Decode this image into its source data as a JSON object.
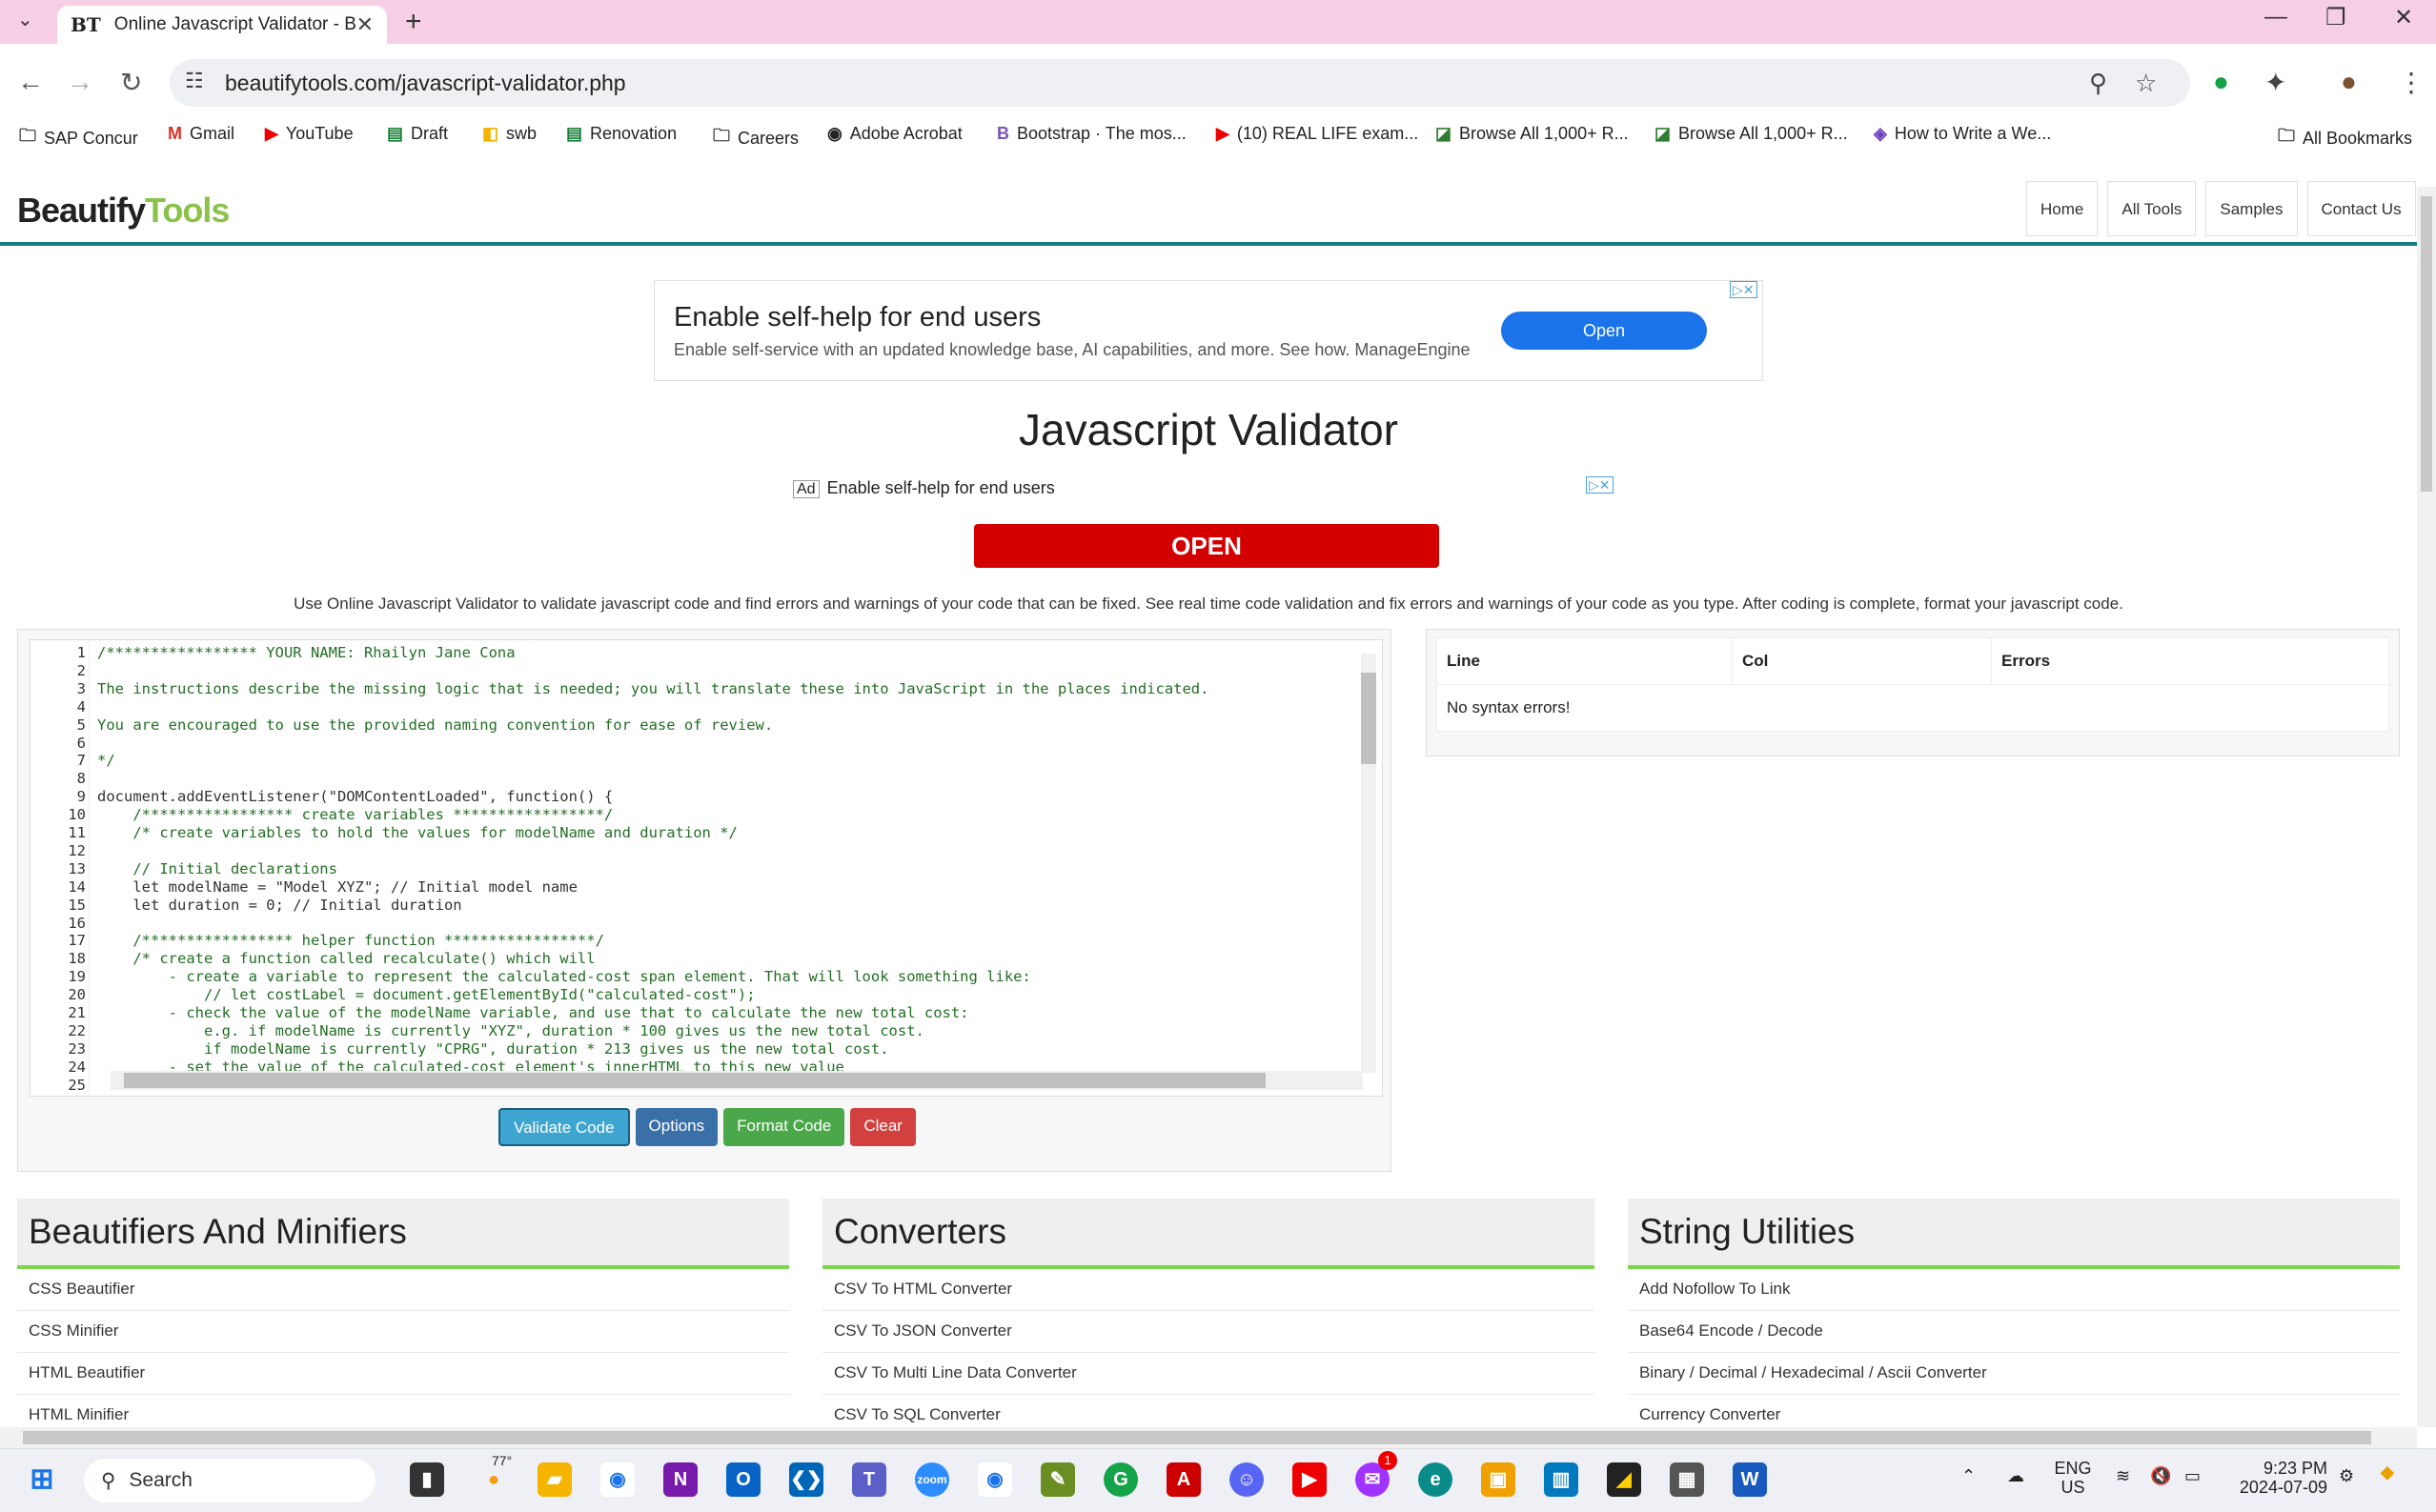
{
  "browser": {
    "tab_favicon": "BT",
    "tab_title": "Online Javascript Validator - Be",
    "url": "beautifytools.com/javascript-validator.php",
    "bookmarks": [
      {
        "label": "SAP Concur",
        "icon": "folder-icon"
      },
      {
        "label": "Gmail",
        "icon": "gmail-icon"
      },
      {
        "label": "YouTube",
        "icon": "youtube-icon"
      },
      {
        "label": "Draft",
        "icon": "docs-icon"
      },
      {
        "label": "swb",
        "icon": "bookmark-icon"
      },
      {
        "label": "Renovation",
        "icon": "docs-icon"
      },
      {
        "label": "Careers",
        "icon": "folder-icon"
      },
      {
        "label": "Adobe Acrobat",
        "icon": "globe-icon"
      },
      {
        "label": "Bootstrap · The mos...",
        "icon": "bootstrap-icon"
      },
      {
        "label": "(10) REAL LIFE exam...",
        "icon": "youtube-icon"
      },
      {
        "label": "Browse All 1,000+ R...",
        "icon": "bookmark-icon"
      },
      {
        "label": "Browse All 1,000+ R...",
        "icon": "bookmark-icon"
      },
      {
        "label": "How to Write a We...",
        "icon": "bookmark-icon"
      }
    ],
    "all_bookmarks": "All Bookmarks"
  },
  "site": {
    "logo_part1": "Beautify",
    "logo_part2": "Tools",
    "nav": [
      "Home",
      "All Tools",
      "Samples",
      "Contact Us"
    ]
  },
  "ad_top": {
    "headline": "Enable self-help for end users",
    "sub": "Enable self-service with an updated knowledge base, AI capabilities, and more. See how. ManageEngine",
    "button": "Open"
  },
  "page_title": "Javascript Validator",
  "ad_mid": {
    "ad_label": "Ad",
    "text": "Enable self-help for end users",
    "button": "OPEN"
  },
  "description": "Use Online Javascript Validator to validate javascript code and find errors and warnings of your code that can be fixed. See real time code validation and fix errors and warnings of your code as you type. After coding is complete, format your javascript code.",
  "editor": {
    "lines": [
      {
        "n": "1",
        "t": "/***************** YOUR NAME: Rhailyn Jane Cona"
      },
      {
        "n": "2",
        "t": ""
      },
      {
        "n": "3",
        "t": "The instructions describe the missing logic that is needed; you will translate these into JavaScript in the places indicated."
      },
      {
        "n": "4",
        "t": ""
      },
      {
        "n": "5",
        "t": "You are encouraged to use the provided naming convention for ease of review."
      },
      {
        "n": "6",
        "t": ""
      },
      {
        "n": "7",
        "t": "*/"
      },
      {
        "n": "8",
        "t": ""
      },
      {
        "n": "9",
        "t": "document.addEventListener(\"DOMContentLoaded\", function() {"
      },
      {
        "n": "10",
        "t": "    /***************** create variables *****************/"
      },
      {
        "n": "11",
        "t": "    /* create variables to hold the values for modelName and duration */"
      },
      {
        "n": "12",
        "t": ""
      },
      {
        "n": "13",
        "t": "    // Initial declarations"
      },
      {
        "n": "14",
        "t": "    let modelName = \"Model XYZ\"; // Initial model name"
      },
      {
        "n": "15",
        "t": "    let duration = 0; // Initial duration"
      },
      {
        "n": "16",
        "t": ""
      },
      {
        "n": "17",
        "t": "    /***************** helper function *****************/"
      },
      {
        "n": "18",
        "t": "    /* create a function called recalculate() which will"
      },
      {
        "n": "19",
        "t": "        - create a variable to represent the calculated-cost span element. That will look something like:"
      },
      {
        "n": "20",
        "t": "            // let costLabel = document.getElementById(\"calculated-cost\");"
      },
      {
        "n": "21",
        "t": "        - check the value of the modelName variable, and use that to calculate the new total cost:"
      },
      {
        "n": "22",
        "t": "            e.g. if modelName is currently \"XYZ\", duration * 100 gives us the new total cost."
      },
      {
        "n": "23",
        "t": "            if modelName is currently \"CPRG\", duration * 213 gives us the new total cost."
      },
      {
        "n": "24",
        "t": "        - set the value of the calculated-cost element's innerHTML to this new value"
      },
      {
        "n": "25",
        "t": ""
      }
    ],
    "buttons": {
      "validate": "Validate Code",
      "options": "Options",
      "format": "Format Code",
      "clear": "Clear"
    }
  },
  "errors": {
    "headers": [
      "Line",
      "Col",
      "Errors"
    ],
    "message": "No syntax errors!"
  },
  "categories": [
    {
      "title": "Beautifiers And Minifiers",
      "items": [
        "CSS Beautifier",
        "CSS Minifier",
        "HTML Beautifier",
        "HTML Minifier"
      ]
    },
    {
      "title": "Converters",
      "items": [
        "CSV To HTML Converter",
        "CSV To JSON Converter",
        "CSV To Multi Line Data Converter",
        "CSV To SQL Converter"
      ]
    },
    {
      "title": "String Utilities",
      "items": [
        "Add Nofollow To Link",
        "Base64 Encode / Decode",
        "Binary / Decimal / Hexadecimal / Ascii Converter",
        "Currency Converter"
      ]
    }
  ],
  "taskbar": {
    "search_placeholder": "Search",
    "weather": "77°",
    "lang": "ENG",
    "region": "US",
    "time": "9:23 PM",
    "date": "2024-07-09",
    "messenger_badge": "1"
  }
}
